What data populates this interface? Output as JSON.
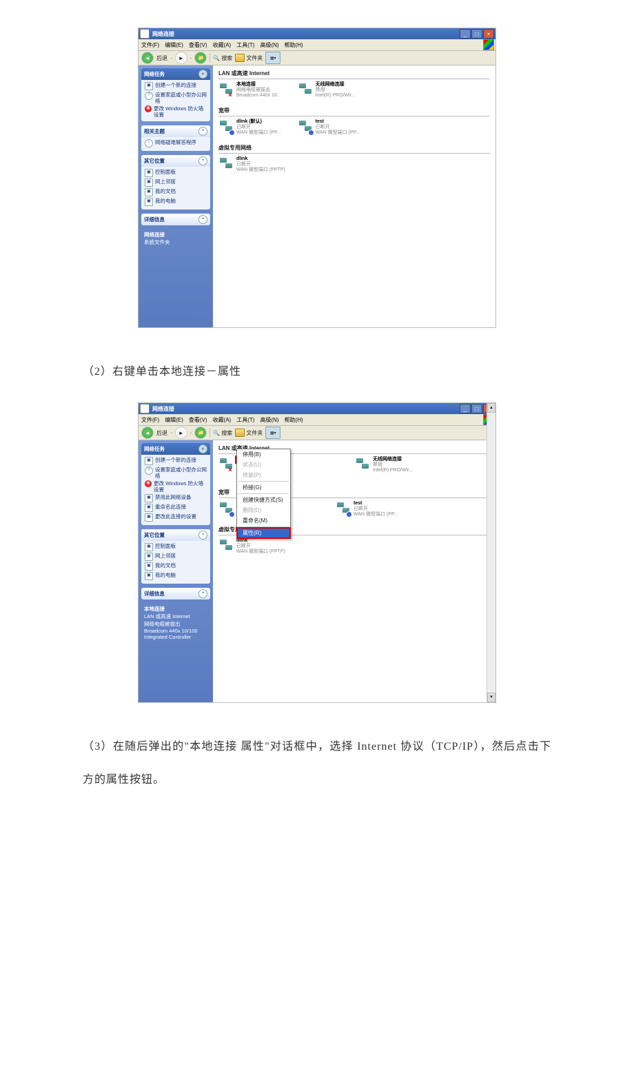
{
  "window": {
    "title": "网络连接",
    "menus": [
      "文件(F)",
      "编辑(E)",
      "查看(V)",
      "收藏(A)",
      "工具(T)",
      "高级(N)",
      "帮助(H)"
    ],
    "toolbar": {
      "back": "后退",
      "search": "搜索",
      "folders": "文件夹"
    }
  },
  "sidebar1": {
    "tasks": {
      "title": "网络任务",
      "items": [
        "创建一个新的连接",
        "设置家庭或小型办公网络",
        "更改 Windows 防火墙设置"
      ]
    },
    "related": {
      "title": "相关主题",
      "items": [
        "网络疑难解答程序"
      ]
    },
    "other": {
      "title": "其它位置",
      "items": [
        "控制面板",
        "网上邻居",
        "我的文档",
        "我的电脑"
      ]
    },
    "detail": {
      "title": "详细信息",
      "name": "网络连接",
      "type": "系统文件夹"
    }
  },
  "sidebar2": {
    "tasks": {
      "title": "网络任务",
      "items": [
        "创建一个新的连接",
        "设置家庭或小型办公网络",
        "更改 Windows 防火墙设置",
        "禁用此网络设备",
        "重命名此连接",
        "更改此连接的设置"
      ]
    },
    "other": {
      "title": "其它位置",
      "items": [
        "控制面板",
        "网上邻居",
        "我的文档",
        "我的电脑"
      ]
    },
    "detail": {
      "title": "详细信息",
      "name": "本地连接",
      "line1": "LAN 或高速 Internet",
      "line2": "网络电缆被拔出",
      "line3": "Broadcom 440x 10/100 Integrated Controller"
    }
  },
  "main1": {
    "group1": "LAN 或高速 Internet",
    "conn1": {
      "name": "本地连接",
      "l2": "网络电缆被拔出",
      "l3": "Broadcom 440x 10..."
    },
    "conn2": {
      "name": "无线网络连接",
      "l2": "禁用",
      "l3": "Intel(R) PRO/Wir..."
    },
    "group2": "宽带",
    "conn3": {
      "name": "dlink (默认)",
      "l2": "已断开",
      "l3": "WAN 微型端口 (PP..."
    },
    "conn4": {
      "name": "test",
      "l2": "已断开",
      "l3": "WAN 微型端口 (PP..."
    },
    "group3": "虚拟专用网络",
    "conn5": {
      "name": "dlink",
      "l2": "已断开",
      "l3": "WAN 微型端口 (PPTP)"
    }
  },
  "ctx": {
    "sel": "本地连接",
    "items": [
      {
        "t": "停用(B)",
        "d": false
      },
      {
        "t": "状态(U)",
        "d": true
      },
      {
        "t": "修复(P)",
        "d": true
      },
      {
        "t": "-"
      },
      {
        "t": "桥接(G)",
        "d": false
      },
      {
        "t": "-"
      },
      {
        "t": "创建快捷方式(S)",
        "d": false
      },
      {
        "t": "删除(D)",
        "d": true
      },
      {
        "t": "重命名(M)",
        "d": false
      },
      {
        "t": "-"
      },
      {
        "t": "属性(R)",
        "d": false,
        "sel": true
      }
    ]
  },
  "instr2": "（2）右键单击本地连接－属性",
  "instr3": "（3）在随后弹出的\"本地连接  属性\"对话框中，选择 Internet 协议（TCP/IP），然后点击下方的属性按钮。"
}
